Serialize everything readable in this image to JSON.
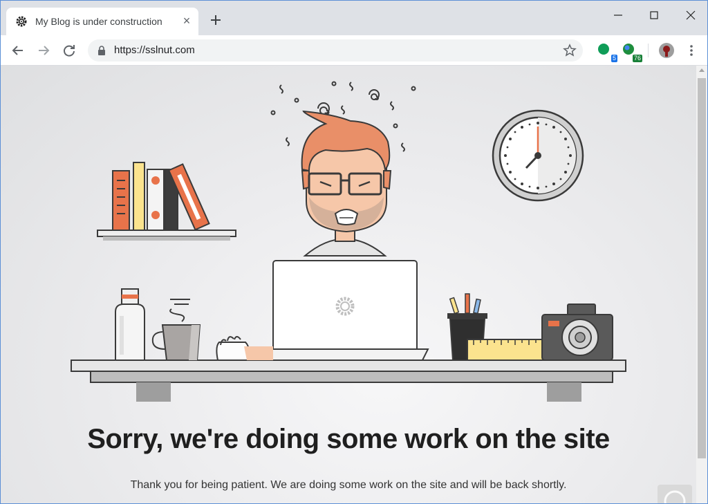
{
  "browser": {
    "tab": {
      "title": "My Blog is under construction",
      "favicon": "gear-icon",
      "close_label": "×"
    },
    "address_bar": {
      "url": "https://sslnut.com"
    },
    "extensions": [
      {
        "name": "extension-green",
        "badge": "5",
        "badge_color": "#1a73e8",
        "color": "#0f9d58"
      },
      {
        "name": "extension-globe",
        "badge": "76",
        "badge_color": "#188038",
        "color": "#1e8e3e"
      }
    ]
  },
  "page": {
    "heading": "Sorry, we're doing some work on the site",
    "message": "Thank you for being patient. We are doing some work on the site and will be back shortly."
  },
  "colors": {
    "accent_orange": "#e8734a",
    "hair": "#e98f68",
    "background": "#e9eaeb"
  }
}
